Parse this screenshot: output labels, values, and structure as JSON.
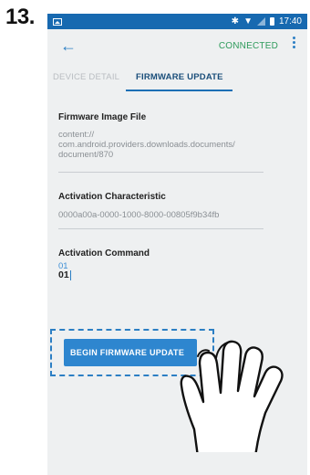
{
  "step_number": "13.",
  "status_bar": {
    "time": "17:40",
    "icons": [
      "gallery-icon",
      "bluetooth-icon",
      "wifi-icon",
      "signal-icon",
      "battery-icon"
    ]
  },
  "app_bar": {
    "back_icon": "arrow-left-icon",
    "connected_label": "CONNECTED",
    "menu_icon": "overflow-menu-icon"
  },
  "tabs": [
    {
      "label": "DEVICE DETAIL",
      "active": false
    },
    {
      "label": "FIRMWARE UPDATE",
      "active": true
    }
  ],
  "sections": {
    "firmware_image": {
      "label": "Firmware Image File",
      "value_lines": [
        "content://",
        "com.android.providers.downloads.documents/",
        "document/870"
      ]
    },
    "activation_characteristic": {
      "label": "Activation Characteristic",
      "value": "0000a00a-0000-1000-8000-00805f9b34fb"
    },
    "activation_command": {
      "label": "Activation Command",
      "hint": "01",
      "value": "01"
    }
  },
  "begin_button_label": "BEGIN FIRMWARE UPDATE",
  "colors": {
    "status_bar": "#1769b0",
    "accent_blue": "#2e86cf",
    "connected_green": "#2f9b5c",
    "screen_background": "#eef0f1"
  }
}
